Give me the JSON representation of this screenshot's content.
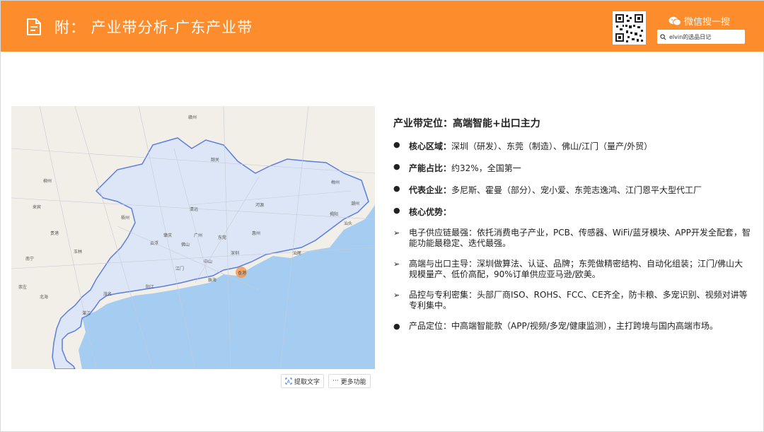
{
  "header": {
    "title": "附： 产业带分析-广东产业带",
    "wechat_label": "微信搜一搜",
    "search_value": "elvin的选品日记",
    "bg_color": "#fd8c2c"
  },
  "map": {
    "labels": [
      "赣州",
      "梅州",
      "潮州",
      "汕头",
      "揭阳",
      "韶关",
      "清远",
      "河源",
      "惠州",
      "广州",
      "佛山",
      "东莞",
      "深圳",
      "香港",
      "中山",
      "珠海",
      "江门",
      "肇庆",
      "云浮",
      "茂名",
      "阳江",
      "湛江",
      "梧州",
      "柳州",
      "来宾",
      "贵港",
      "玉林",
      "北海",
      "汕尾",
      "南宁",
      "崇左"
    ],
    "tools": {
      "extract": "提取文字",
      "more": "更多功能"
    }
  },
  "content": {
    "heading": "产业带定位：高端智能+出口主力",
    "items": [
      {
        "label": "核心区域：",
        "text": "深圳（研发）、东莞（制造）、佛山/江门（量产/外贸）"
      },
      {
        "label": "产能占比：",
        "text": "约32%，全国第一"
      },
      {
        "label": "代表企业：",
        "text": "多尼斯、霍曼（部分）、宠小爱、东莞志逸鸿、江门恩平大型代工厂"
      },
      {
        "label": "核心优势：",
        "text": ""
      }
    ],
    "advantages": [
      "电子供应链最强：依托消费电子产业，PCB、传感器、WiFi/蓝牙模块、APP开发全配套，智能功能最稳定、迭代最强。",
      "高端与出口主导：深圳做算法、认证、品牌；东莞做精密结构、自动化组装；江门/佛山大规模量产、低价高配，90%订单供应亚马逊/欧美。",
      "品控与专利密集：头部厂商ISO、ROHS、FCC、CE齐全，防卡粮、多宠识别、视频对讲等专利集中。"
    ],
    "positioning": "产品定位：中高端智能款（APP/视频/多宠/健康监测），主打跨境与国内高端市场。"
  }
}
